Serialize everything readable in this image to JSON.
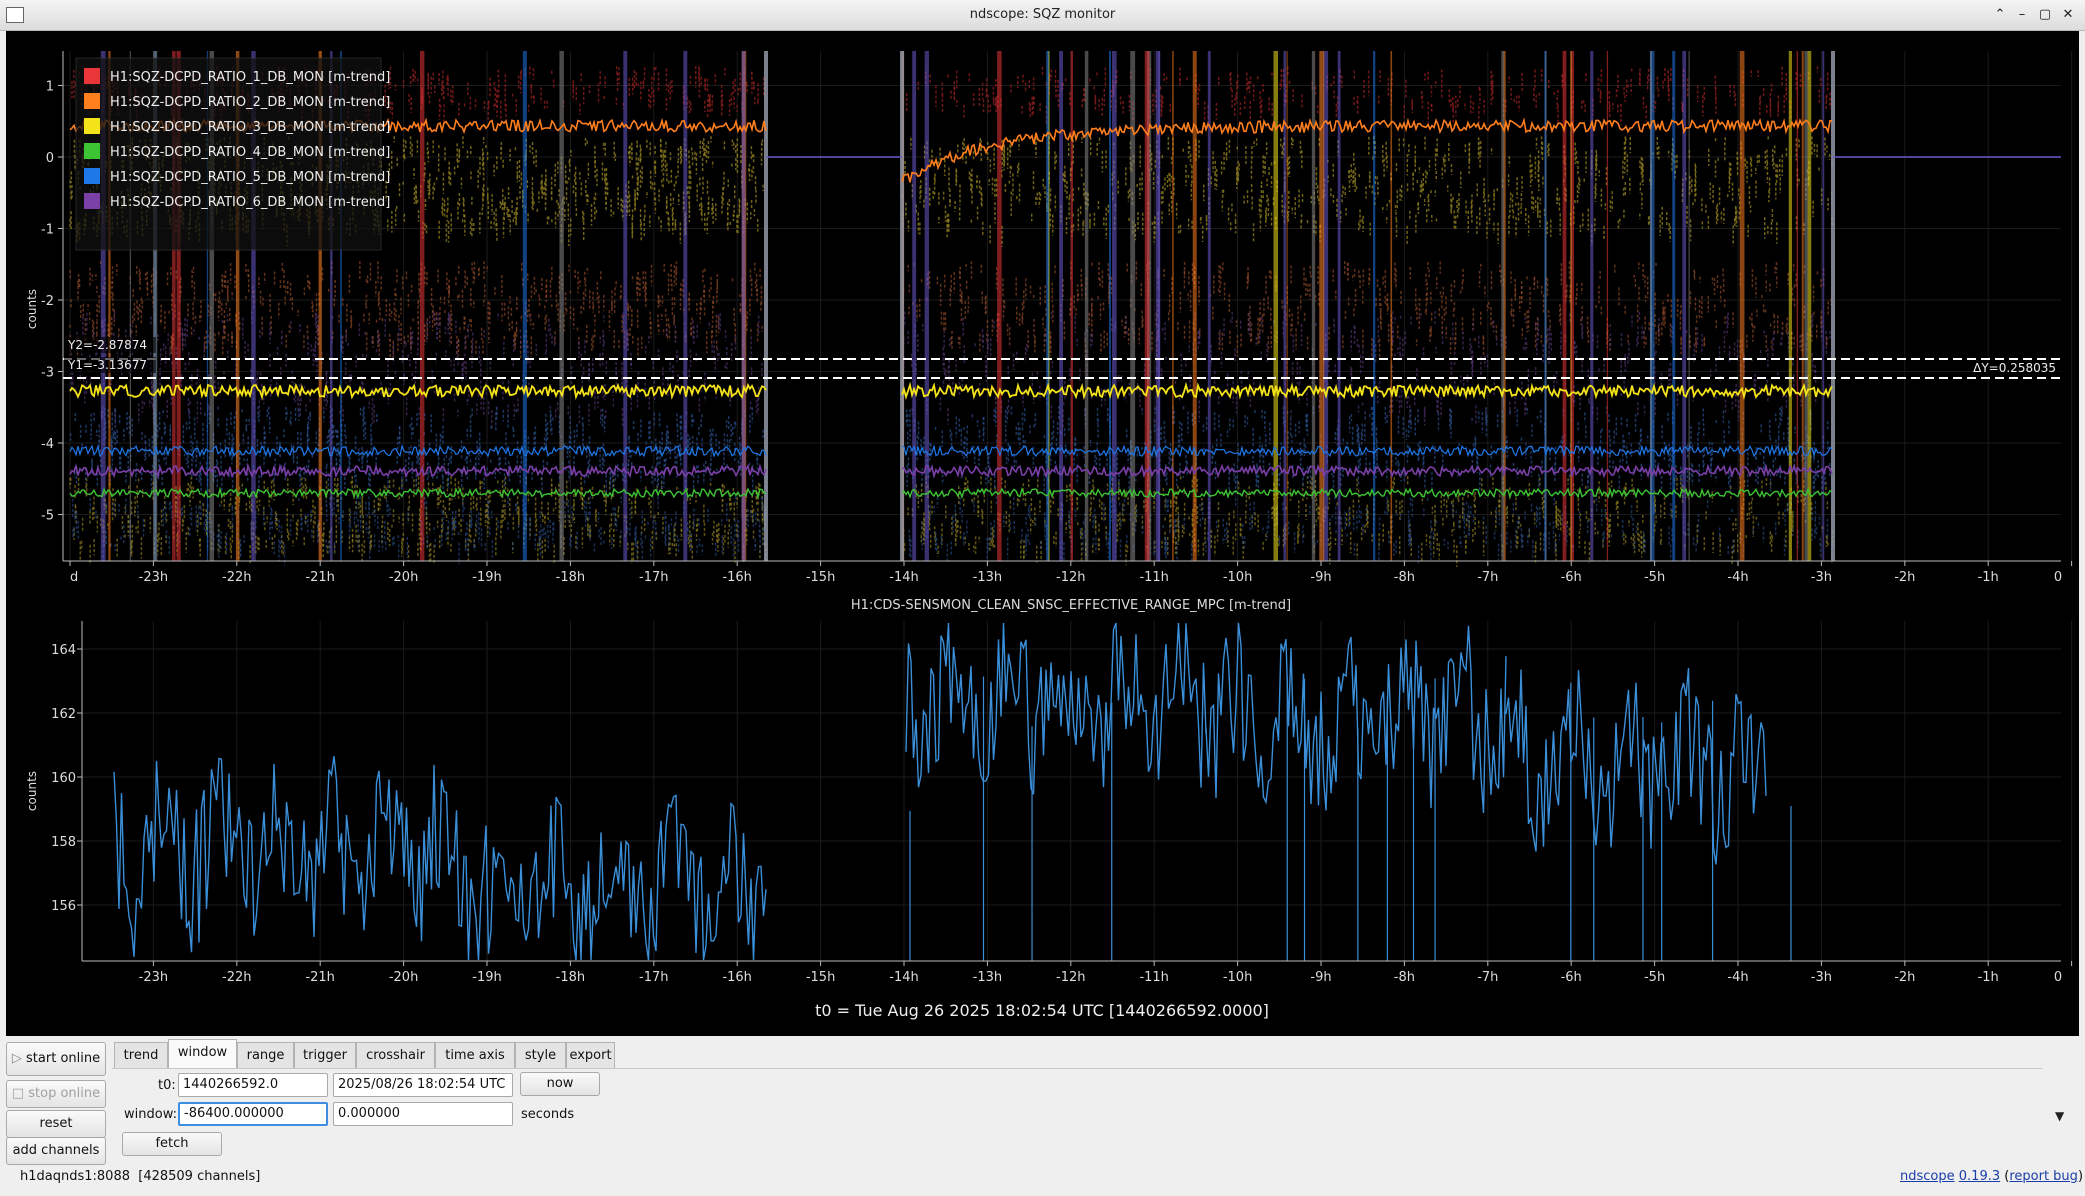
{
  "window": {
    "title": "ndscope: SQZ monitor",
    "controls": [
      "minimize",
      "maximize",
      "close",
      "shade"
    ]
  },
  "plot1": {
    "ylabel": "counts",
    "yticks": [
      "1",
      "0",
      "-1",
      "-2",
      "-3",
      "-4",
      "-5"
    ],
    "xticks": [
      "d",
      "-23h",
      "-22h",
      "-21h",
      "-20h",
      "-19h",
      "-18h",
      "-17h",
      "-16h",
      "-15h",
      "-14h",
      "-13h",
      "-12h",
      "-11h",
      "-10h",
      "-9h",
      "-8h",
      "-7h",
      "-6h",
      "-5h",
      "-4h",
      "-3h",
      "-2h",
      "-1h",
      "0"
    ],
    "legend": [
      {
        "name": "H1:SQZ-DCPD_RATIO_1_DB_MON [m-trend]",
        "color": "#e8363a"
      },
      {
        "name": "H1:SQZ-DCPD_RATIO_2_DB_MON [m-trend]",
        "color": "#ff7f1e"
      },
      {
        "name": "H1:SQZ-DCPD_RATIO_3_DB_MON [m-trend]",
        "color": "#f5e31a"
      },
      {
        "name": "H1:SQZ-DCPD_RATIO_4_DB_MON [m-trend]",
        "color": "#3dc435"
      },
      {
        "name": "H1:SQZ-DCPD_RATIO_5_DB_MON [m-trend]",
        "color": "#1f78e8"
      },
      {
        "name": "H1:SQZ-DCPD_RATIO_6_DB_MON [m-trend]",
        "color": "#7b3fa8"
      }
    ],
    "cursor_y2": "Y2=-2.87874",
    "cursor_y1": "Y1=-3.13677",
    "delta_y": "ΔY=0.258035"
  },
  "plot2": {
    "title": "H1:CDS-SENSMON_CLEAN_SNSC_EFFECTIVE_RANGE_MPC [m-trend]",
    "ylabel": "counts",
    "yticks": [
      "164",
      "162",
      "160",
      "158",
      "156"
    ],
    "xticks": [
      "-23h",
      "-22h",
      "-21h",
      "-20h",
      "-19h",
      "-18h",
      "-17h",
      "-16h",
      "-15h",
      "-14h",
      "-13h",
      "-12h",
      "-11h",
      "-10h",
      "-9h",
      "-8h",
      "-7h",
      "-6h",
      "-5h",
      "-4h",
      "-3h",
      "-2h",
      "-1h",
      "0"
    ],
    "color": "#3a8fd8"
  },
  "t0_label": "t0 = Tue Aug 26 2025 18:02:54 UTC [1440266592.0000]",
  "side_buttons": {
    "start_online": "start online",
    "stop_online": "stop online",
    "reset": "reset",
    "add_channels": "add channels"
  },
  "tabs": [
    "trend",
    "window",
    "range",
    "trigger",
    "crosshair",
    "time axis",
    "style",
    "export"
  ],
  "active_tab": "window",
  "window_tab": {
    "t0_label": "t0:",
    "t0_gps": "1440266592.0",
    "t0_utc": "2025/08/26 18:02:54 UTC",
    "now_button": "now",
    "window_label": "window:",
    "window_start": "-86400.000000",
    "window_end": "0.000000",
    "seconds_label": "seconds",
    "fetch_button": "fetch"
  },
  "status": {
    "server": "h1daqnds1:8088",
    "channels": "[428509 channels]",
    "app_link": "ndscope",
    "version_link": "0.19.3",
    "report_link": "report bug"
  }
}
